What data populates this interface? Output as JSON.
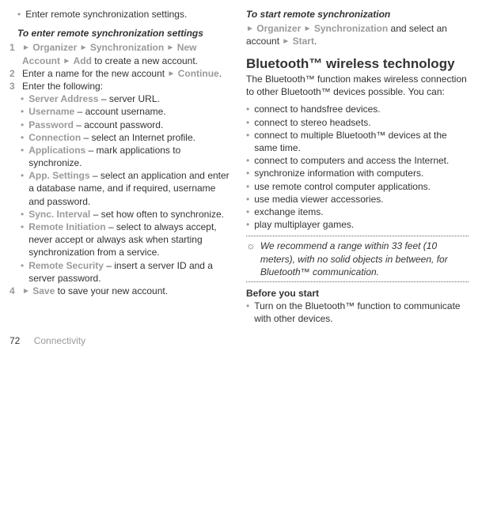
{
  "left": {
    "topItem": "Enter remote synchronization settings.",
    "subhead": "To enter remote synchronization settings",
    "step1_nav": [
      "Organizer",
      "Synchronization",
      "New Account",
      "Add"
    ],
    "step1_tail": " to create a new account.",
    "step2_pre": "Enter a name for the new account ",
    "step2_nav": "Continue",
    "step3": "Enter the following:",
    "sub": [
      {
        "label": "Server Address",
        "desc": " – server URL."
      },
      {
        "label": "Username",
        "desc": " – account username."
      },
      {
        "label": "Password",
        "desc": " – account password."
      },
      {
        "label": "Connection",
        "desc": " – select an Internet profile."
      },
      {
        "label": "Applications",
        "desc": " – mark applications to synchronize."
      },
      {
        "label": "App. Settings",
        "desc": " – select an application and enter a database name, and if required, username and password."
      },
      {
        "label": "Sync. Interval",
        "desc": " – set how often to synchronize."
      },
      {
        "label": "Remote Initiation",
        "desc": " – select to always accept, never accept or always ask when starting synchronization from a service."
      },
      {
        "label": "Remote Security",
        "desc": " – insert a server ID and a server password."
      }
    ],
    "step4_nav": "Save",
    "step4_tail": " to save your new account."
  },
  "right": {
    "startHead": "To start remote synchronization",
    "start_nav": [
      "Organizer",
      "Synchronization"
    ],
    "start_mid": " and select an account ",
    "start_nav2": "Start",
    "btHead": "Bluetooth™ wireless technology",
    "btIntro": "The Bluetooth™ function makes wireless connection to other Bluetooth™ devices possible. You can:",
    "btList": [
      "connect to handsfree devices.",
      "connect to stereo headsets.",
      "connect to multiple Bluetooth™ devices at the same time.",
      "connect to computers and access the Internet.",
      "synchronize information with computers.",
      "use remote control computer applications.",
      "use media viewer accessories.",
      "exchange items.",
      "play multiplayer games."
    ],
    "tip": "We recommend a range within 33 feet (10 meters), with no solid objects in between, for Bluetooth™ communica­tion.",
    "beforeHead": "Before you start",
    "beforeItem": "Turn on the Bluetooth™ function to communicate with other devices."
  },
  "footer": {
    "page": "72",
    "section": "Connectivity"
  }
}
